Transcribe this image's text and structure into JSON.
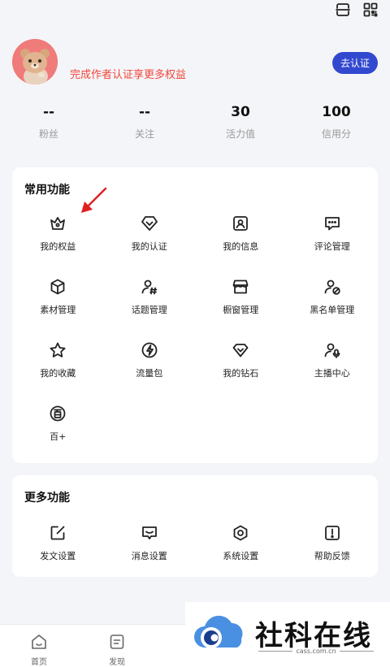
{
  "header": {
    "icons": [
      "scan-icon",
      "qr-code-icon"
    ]
  },
  "profile": {
    "prompt": "完成作者认证享更多权益",
    "verify_button": "去认证"
  },
  "stats": [
    {
      "value": "--",
      "label": "粉丝"
    },
    {
      "value": "--",
      "label": "关注"
    },
    {
      "value": "30",
      "label": "活力值"
    },
    {
      "value": "100",
      "label": "信用分"
    }
  ],
  "common": {
    "title": "常用功能",
    "items": [
      {
        "label": "我的权益",
        "icon": "crown-icon"
      },
      {
        "label": "我的认证",
        "icon": "verify-badge-icon"
      },
      {
        "label": "我的信息",
        "icon": "profile-card-icon"
      },
      {
        "label": "评论管理",
        "icon": "comment-icon"
      },
      {
        "label": "素材管理",
        "icon": "cube-icon"
      },
      {
        "label": "话题管理",
        "icon": "topic-hashtag-icon"
      },
      {
        "label": "橱窗管理",
        "icon": "store-icon"
      },
      {
        "label": "黑名单管理",
        "icon": "block-user-icon"
      },
      {
        "label": "我的收藏",
        "icon": "star-icon"
      },
      {
        "label": "流量包",
        "icon": "lightning-icon"
      },
      {
        "label": "我的钻石",
        "icon": "diamond-icon"
      },
      {
        "label": "主播中心",
        "icon": "anchor-mic-icon"
      },
      {
        "label": "百+",
        "icon": "bai-plus-icon"
      }
    ]
  },
  "more": {
    "title": "更多功能",
    "items": [
      {
        "label": "发文设置",
        "icon": "edit-icon"
      },
      {
        "label": "消息设置",
        "icon": "message-icon"
      },
      {
        "label": "系统设置",
        "icon": "settings-icon"
      },
      {
        "label": "帮助反馈",
        "icon": "help-icon"
      }
    ]
  },
  "tabbar": [
    {
      "label": "首页",
      "icon": "home-icon"
    },
    {
      "label": "发现",
      "icon": "discover-icon"
    }
  ],
  "watermark": {
    "text": "社科在线",
    "url": "cass.com.cn"
  },
  "colors": {
    "accent": "#3249cf",
    "prompt": "#f2463c",
    "annotation_arrow": "#e02020"
  }
}
